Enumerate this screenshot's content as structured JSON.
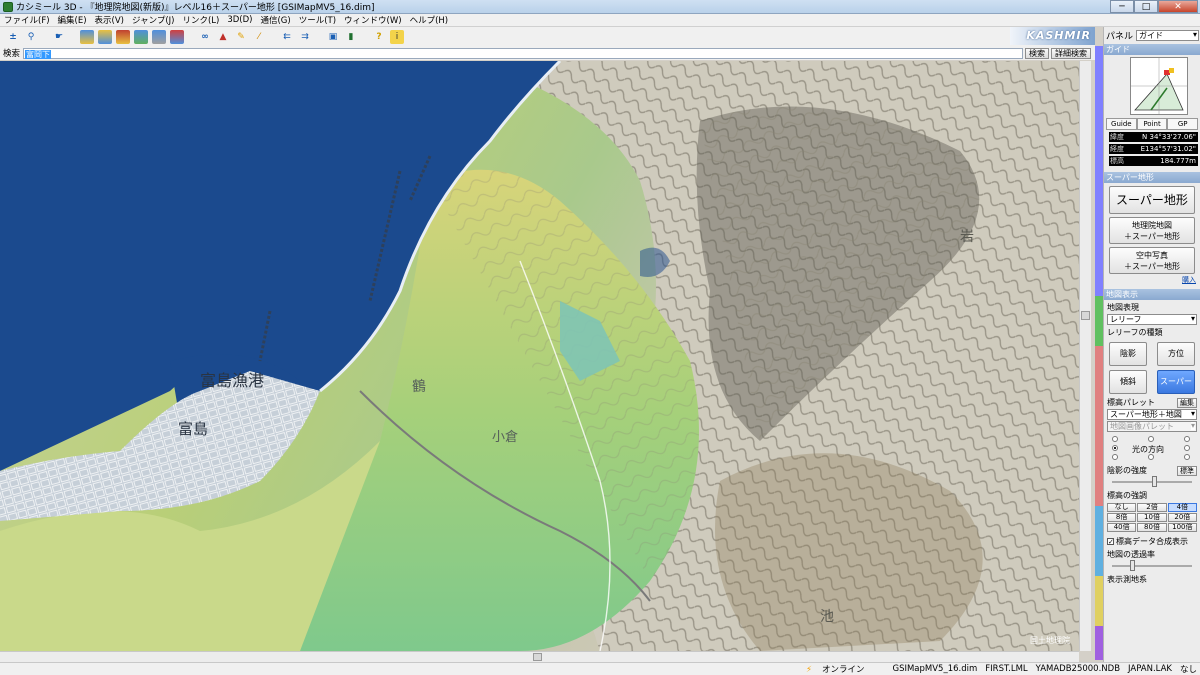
{
  "window": {
    "title": "カシミール 3D - 『地理院地図(新版)』レベル16＋スーパー地形 [GSIMapMV5_16.dim]",
    "buttons": [
      "─",
      "□",
      "✕"
    ]
  },
  "menu": [
    "ファイル(F)",
    "編集(E)",
    "表示(V)",
    "ジャンプ(J)",
    "リンク(L)",
    "3D(D)",
    "通信(G)",
    "ツール(T)",
    "ウィンドウ(W)",
    "ヘルプ(H)"
  ],
  "toolbar": {
    "brand": "KASHMIR 3D",
    "icons": [
      "add-point-icon",
      "search-icon",
      "hand-icon",
      "layer-icon",
      "layer-icon",
      "layer-icon",
      "layer-icon",
      "layer-icon",
      "layer-icon",
      "binoculars-icon",
      "mountain-icon",
      "pen-icon",
      "ruler-icon",
      "back-icon",
      "forward-icon",
      "camera-icon",
      "gps-icon",
      "help-icon",
      "info-icon"
    ]
  },
  "search": {
    "label": "検索",
    "value": "富岡下",
    "search_button": "検索",
    "detail_button": "詳細検索"
  },
  "map": {
    "labels": {
      "port": "富島漁港",
      "town": "富島",
      "place1": "小倉",
      "place2": "鶴",
      "place3": "岩",
      "place4": "池",
      "credit": "国土地理院"
    }
  },
  "panel": {
    "panel_label": "パネル",
    "panel_select": "ガイド",
    "guide": {
      "header": "ガイド",
      "tabs": [
        "Guide",
        "Point",
        "GP"
      ],
      "lat_label": "緯度",
      "lat_value": "N 34°33'27.06\"",
      "lon_label": "経度",
      "lon_value": "E134°57'31.02\"",
      "alt_label": "標高",
      "alt_value": "184.777m"
    },
    "super": {
      "header": "スーパー地形",
      "btn_super": "スーパー地形",
      "btn_gsi_line1": "地理院地図",
      "btn_gsi_line2": "＋スーパー地形",
      "btn_photo_line1": "空中写真",
      "btn_photo_line2": "＋スーパー地形",
      "link": "購入"
    },
    "display": {
      "header": "地図表示",
      "expr_label": "地図表現",
      "expr_value": "レリーフ",
      "relief_kind_label": "レリーフの種類",
      "btn_shade": "陰影",
      "btn_dir": "方位",
      "btn_slope": "傾斜",
      "btn_super": "スーパー",
      "palette_label": "標高パレット",
      "edit": "編集",
      "palette_value": "スーパー地形＋地図",
      "image_palette": "地図画像パレット",
      "light_dir": "光の方向",
      "shade_strength": "陰影の強度",
      "standard": "標準",
      "emph_label": "標高の強調",
      "emph": [
        "なし",
        "2倍",
        "4倍",
        "8倍",
        "10倍",
        "20倍",
        "40倍",
        "80倍",
        "100倍"
      ],
      "emph_selected": "4倍",
      "composite": "標高データ合成表示",
      "opacity": "地図の透過率",
      "display_label": "表示測地系"
    }
  },
  "status": {
    "online": "オンライン",
    "items": [
      "GSIMapMV5_16.dim",
      "FIRST.LML",
      "YAMADB25000.NDB",
      "JAPAN.LAK",
      "なし"
    ]
  },
  "colors": {
    "sea": "#1b4a8e",
    "accent": "#3b78e0",
    "strip": [
      "#8080ff",
      "#8080ff",
      "#60c060",
      "#e08080",
      "#e08080",
      "#60b0e0",
      "#e0d060",
      "#a060e0"
    ]
  }
}
